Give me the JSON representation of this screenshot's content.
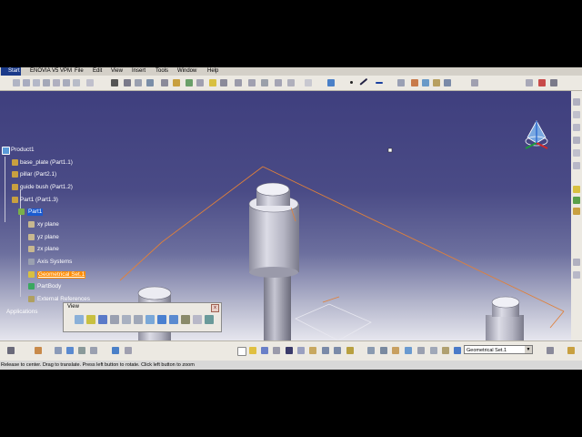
{
  "menubar": {
    "start": "Start",
    "items": [
      "ENOVIA V5 VPM",
      "File",
      "Edit",
      "View",
      "Insert",
      "Tools",
      "Window",
      "Help"
    ]
  },
  "tree": {
    "root": "Product1",
    "items": [
      {
        "label": "base_plate (Part1.1)"
      },
      {
        "label": "pillar (Part2.1)"
      },
      {
        "label": "guide bush (Part1.2)"
      },
      {
        "label": "Part1 (Part1.3)"
      }
    ],
    "part": "Part1",
    "planes": [
      "xy plane",
      "yz plane",
      "zx plane"
    ],
    "axis_systems": "Axis Systems",
    "geometrical_set": "Geometrical Set.1",
    "part_body": "PartBody",
    "external_references": "External References",
    "applications": "Applications"
  },
  "view_toolbar": {
    "title": "View",
    "close": "x"
  },
  "workbench": {
    "current_set": "Geometrical Set.1"
  },
  "status": {
    "message": "Release to center. Drag to translate. Press left button to rotate. Click left button to zoom"
  },
  "colors": {
    "viewport_top": "#3f3f7e",
    "viewport_bottom": "#e6e6ee",
    "selection_highlight": "#ff8c00",
    "sketch_line": "#e0803a",
    "tree_text": "#ffffff"
  },
  "icons": {
    "compass": "compass-icon",
    "start": "catia-start-icon"
  }
}
